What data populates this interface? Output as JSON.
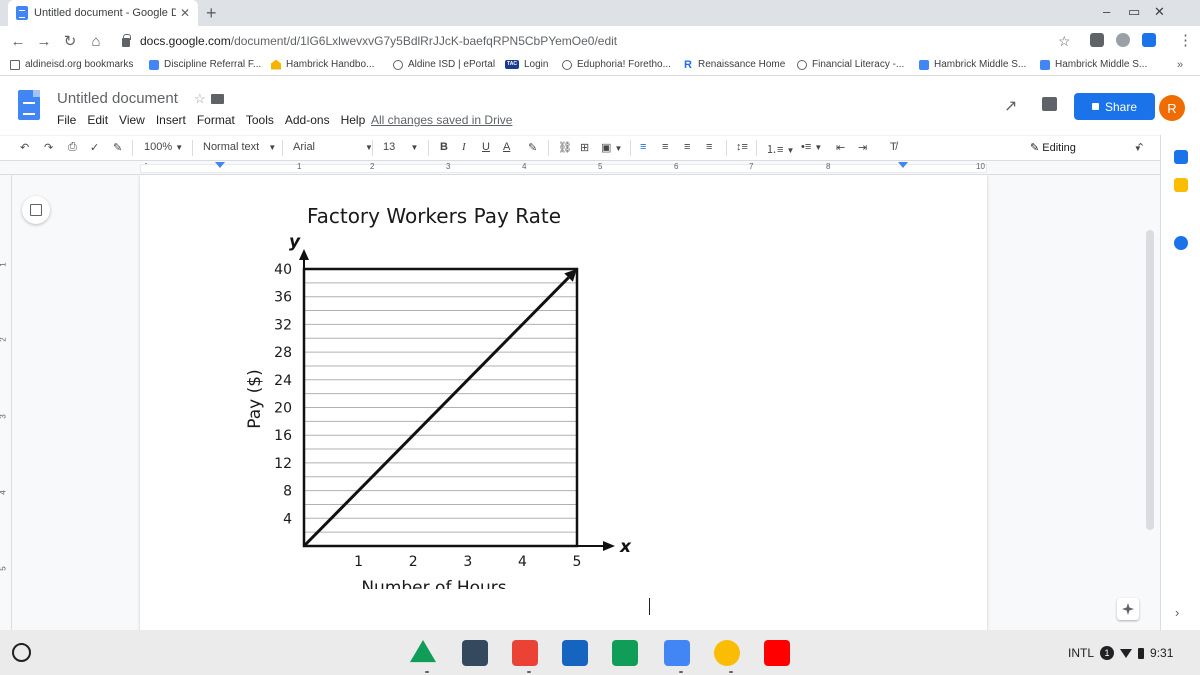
{
  "browser": {
    "tab_title": "Untitled document - Google Doc",
    "tab_close": "✕",
    "new_tab": "+",
    "url_host": "docs.google.com",
    "url_path": "/document/d/1lG6LxlwevxvG7y5BdlRrJJcK-baefqRPN5CbPYemOe0/edit",
    "window_controls": [
      "‒",
      "▭",
      "✕"
    ]
  },
  "bookmarks": [
    {
      "label": "aldineisd.org bookmarks",
      "icon": "folder-icon"
    },
    {
      "label": "Discipline Referral F...",
      "icon": "doc-icon"
    },
    {
      "label": "Hambrick Handbo...",
      "icon": "handbook-icon"
    },
    {
      "label": "Aldine ISD | ePortal",
      "icon": "globe-icon"
    },
    {
      "label": "Login",
      "icon": "tac-icon",
      "badge": "TAC"
    },
    {
      "label": "Eduphoria! Foretho...",
      "icon": "globe-icon"
    },
    {
      "label": "Renaissance Home",
      "icon": "renaissance-icon",
      "badge": "R"
    },
    {
      "label": "Financial Literacy -...",
      "icon": "globe-icon"
    },
    {
      "label": "Hambrick Middle S...",
      "icon": "doc-icon"
    },
    {
      "label": "Hambrick Middle S...",
      "icon": "doc-icon"
    }
  ],
  "bookmarks_more": "»",
  "docs": {
    "title": "Untitled document",
    "menu": [
      "File",
      "Edit",
      "View",
      "Insert",
      "Format",
      "Tools",
      "Add-ons",
      "Help"
    ],
    "save_status": "All changes saved in Drive",
    "share_label": "Share",
    "account_initial": "R",
    "accent": "#1a73e8"
  },
  "format_toolbar": {
    "zoom": "100%",
    "style": "Normal text",
    "font": "Arial",
    "font_size": "13",
    "bold": "B",
    "italic": "I",
    "underline": "U",
    "text_color": "A",
    "mode": "Editing"
  },
  "ruler_numbers": [
    "1",
    "1",
    "2",
    "3",
    "4",
    "5",
    "6",
    "7",
    "8",
    "10"
  ],
  "vruler_numbers": [
    "1",
    "2",
    "3",
    "4",
    "5"
  ],
  "chart_data": {
    "type": "line",
    "title": "Factory Workers Pay Rate",
    "xlabel": "Number of Hours",
    "ylabel": "Pay ($)",
    "x_axis_letter": "x",
    "y_axis_letter": "y",
    "x_ticks": [
      "1",
      "2",
      "3",
      "4",
      "5"
    ],
    "y_ticks": [
      "4",
      "8",
      "12",
      "16",
      "20",
      "24",
      "28",
      "32",
      "36",
      "40"
    ],
    "xlim": [
      0,
      5
    ],
    "ylim": [
      0,
      40
    ],
    "grid": true,
    "series": [
      {
        "x": [
          0,
          5
        ],
        "y": [
          0,
          40
        ]
      }
    ]
  },
  "shelf": {
    "apps": [
      "drive-icon",
      "app-icon",
      "gmail-icon",
      "app-icon",
      "sheets-icon",
      "docs-icon",
      "chrome-icon",
      "youtube-icon"
    ],
    "ime": "INTL",
    "notification_count": "1",
    "time": "9:31"
  }
}
